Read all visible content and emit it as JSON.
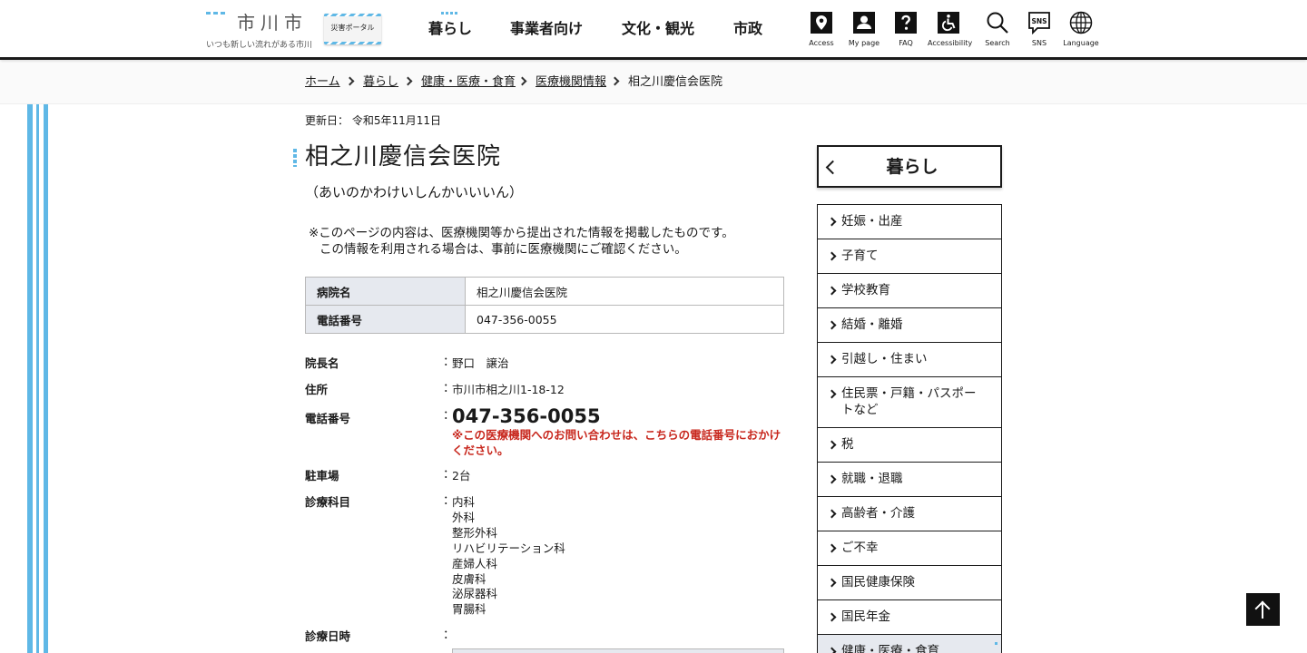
{
  "header": {
    "logo_name": "市川市",
    "logo_tagline": "いつも新しい流れがある市川",
    "portal_label": "災害ポータル",
    "nav": [
      "暮らし",
      "事業者向け",
      "文化・観光",
      "市政"
    ],
    "utils": [
      {
        "label": "Access",
        "icon": "map-pin-icon"
      },
      {
        "label": "My page",
        "icon": "user-icon"
      },
      {
        "label": "FAQ",
        "icon": "question-icon"
      },
      {
        "label": "Accessibility",
        "icon": "wheelchair-icon"
      },
      {
        "label": "Search",
        "icon": "search-icon"
      },
      {
        "label": "SNS",
        "icon": "sns-icon"
      },
      {
        "label": "Language",
        "icon": "globe-icon"
      }
    ]
  },
  "breadcrumb": [
    "ホーム",
    "暮らし",
    "健康・医療・食育",
    "医療機関情報",
    "相之川慶信会医院"
  ],
  "page": {
    "updated": "更新日： 令和5年11月11日",
    "title": "相之川慶信会医院",
    "reading": "（あいのかわけいしんかいいいん）",
    "notice_1": "※このページの内容は、医療機関等から提出された情報を掲載したものです。",
    "notice_2": "この情報を利用される場合は、事前に医療機関にご確認ください。"
  },
  "info_table": [
    {
      "label": "病院名",
      "value": "相之川慶信会医院"
    },
    {
      "label": "電話番号",
      "value": "047-356-0055"
    }
  ],
  "details": {
    "director_label": "院長名",
    "director": "野口　譲治",
    "address_label": "住所",
    "address": "市川市相之川1-18-12",
    "tel_label": "電話番号",
    "tel": "047-356-0055",
    "tel_note": "※この医療機関へのお問い合わせは、こちらの電話番号におかけください。",
    "parking_label": "駐車場",
    "parking": "2台",
    "depts_label": "診療科目",
    "depts": [
      "内科",
      "外科",
      "整形外科",
      "リハビリテーション科",
      "産婦人科",
      "皮膚科",
      "泌尿器科",
      "胃腸科"
    ],
    "hours_label": "診療日時",
    "colon": "："
  },
  "sidenav": {
    "head": "暮らし",
    "items": [
      "妊娠・出産",
      "子育て",
      "学校教育",
      "結婚・離婚",
      "引越し・住まい",
      "住民票・戸籍・パスポートなど",
      "税",
      "就職・退職",
      "高齢者・介護",
      "ご不幸",
      "国民健康保険",
      "国民年金",
      "健康・医療・食育"
    ]
  },
  "colors": {
    "accent": "#5fb8e6",
    "warning": "#c8281e",
    "table_head": "#e6e9ef"
  }
}
